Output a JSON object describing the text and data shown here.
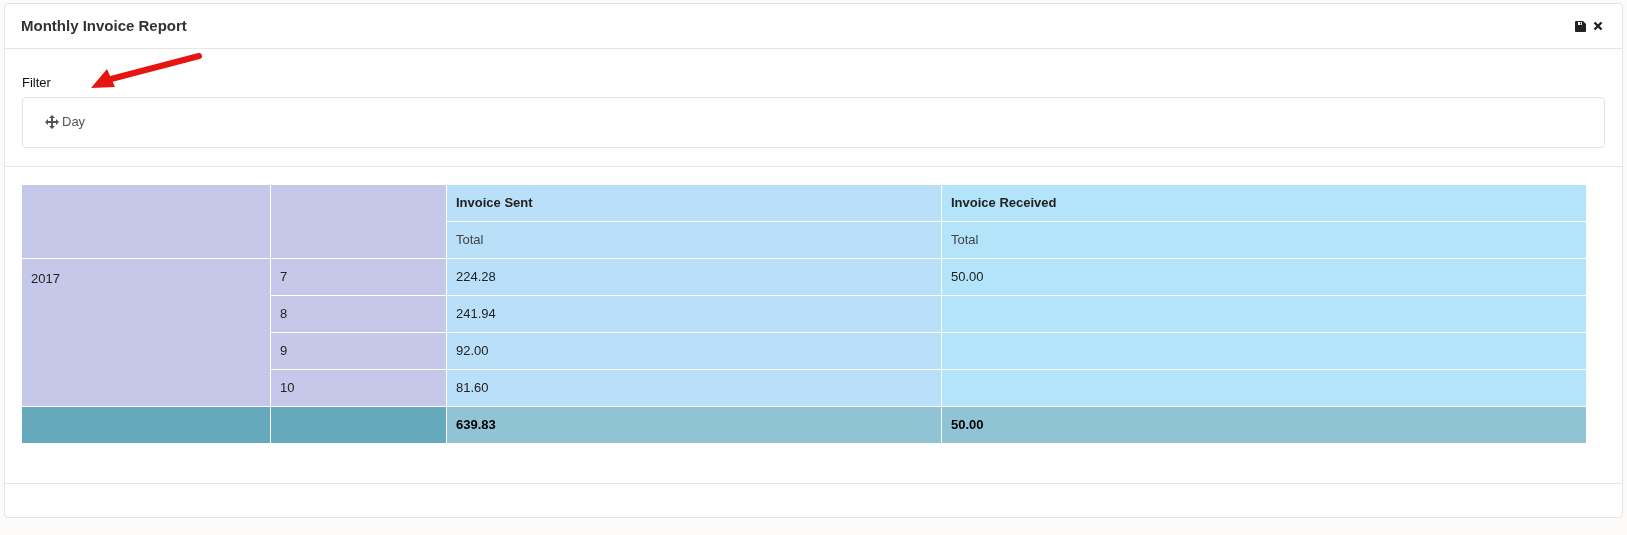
{
  "window": {
    "title": "Monthly Invoice Report"
  },
  "filter": {
    "label": "Filter",
    "fields": [
      "Day"
    ]
  },
  "table": {
    "columns": [
      {
        "label": "Invoice Sent",
        "measure": "Total"
      },
      {
        "label": "Invoice Received",
        "measure": "Total"
      }
    ],
    "groups": [
      {
        "label": "2017",
        "rows": [
          {
            "label": "7",
            "values": [
              "224.28",
              "50.00"
            ]
          },
          {
            "label": "8",
            "values": [
              "241.94"
            ]
          },
          {
            "label": "9",
            "values": [
              "92.00"
            ]
          },
          {
            "label": "10",
            "values": [
              "81.60"
            ]
          }
        ]
      }
    ],
    "totals": [
      "639.83",
      "50.00"
    ]
  }
}
